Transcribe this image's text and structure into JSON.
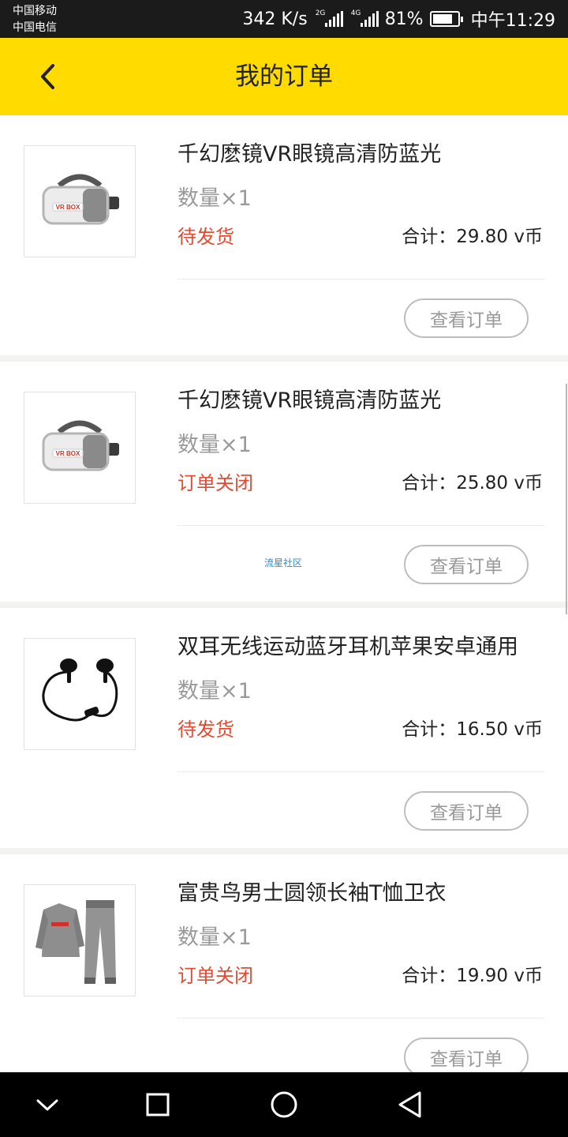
{
  "status_bar": {
    "carrier_1": "中国移动",
    "carrier_2": "中国电信",
    "network_speed": "342 K/s",
    "signal_1_label": "2G",
    "signal_2_label": "4G",
    "battery_percent": "81%",
    "battery_level": 0.81,
    "time": "中午11:29"
  },
  "header": {
    "title": "我的订单",
    "background_color": "#ffdb00"
  },
  "orders": [
    {
      "product_name": "千幻麽镜VR眼镜高清防蓝光",
      "quantity": "数量×1",
      "status": "待发货",
      "total": "合计：29.80 v币",
      "image": "vr-headset",
      "view_label": "查看订单"
    },
    {
      "product_name": "千幻麽镜VR眼镜高清防蓝光",
      "quantity": "数量×1",
      "status": "订单关闭",
      "total": "合计：25.80 v币",
      "image": "vr-headset",
      "view_label": "查看订单"
    },
    {
      "product_name": "双耳无线运动蓝牙耳机苹果安卓通用",
      "quantity": "数量×1",
      "status": "待发货",
      "total": "合计：16.50 v币",
      "image": "bluetooth-earphones",
      "view_label": "查看订单"
    },
    {
      "product_name": "富贵鸟男士圆领长袖T恤卫衣",
      "quantity": "数量×1",
      "status": "订单关闭",
      "total": "合计：19.90 v币",
      "image": "sweatshirt-set",
      "view_label": "查看订单"
    }
  ],
  "watermark": "流星社区",
  "vr_logo_text": "VR BOX",
  "status_color": "#e04b32",
  "nav_bar": {
    "icons": [
      "chevron-down-icon",
      "recent-apps-icon",
      "home-icon",
      "back-triangle-icon"
    ]
  }
}
